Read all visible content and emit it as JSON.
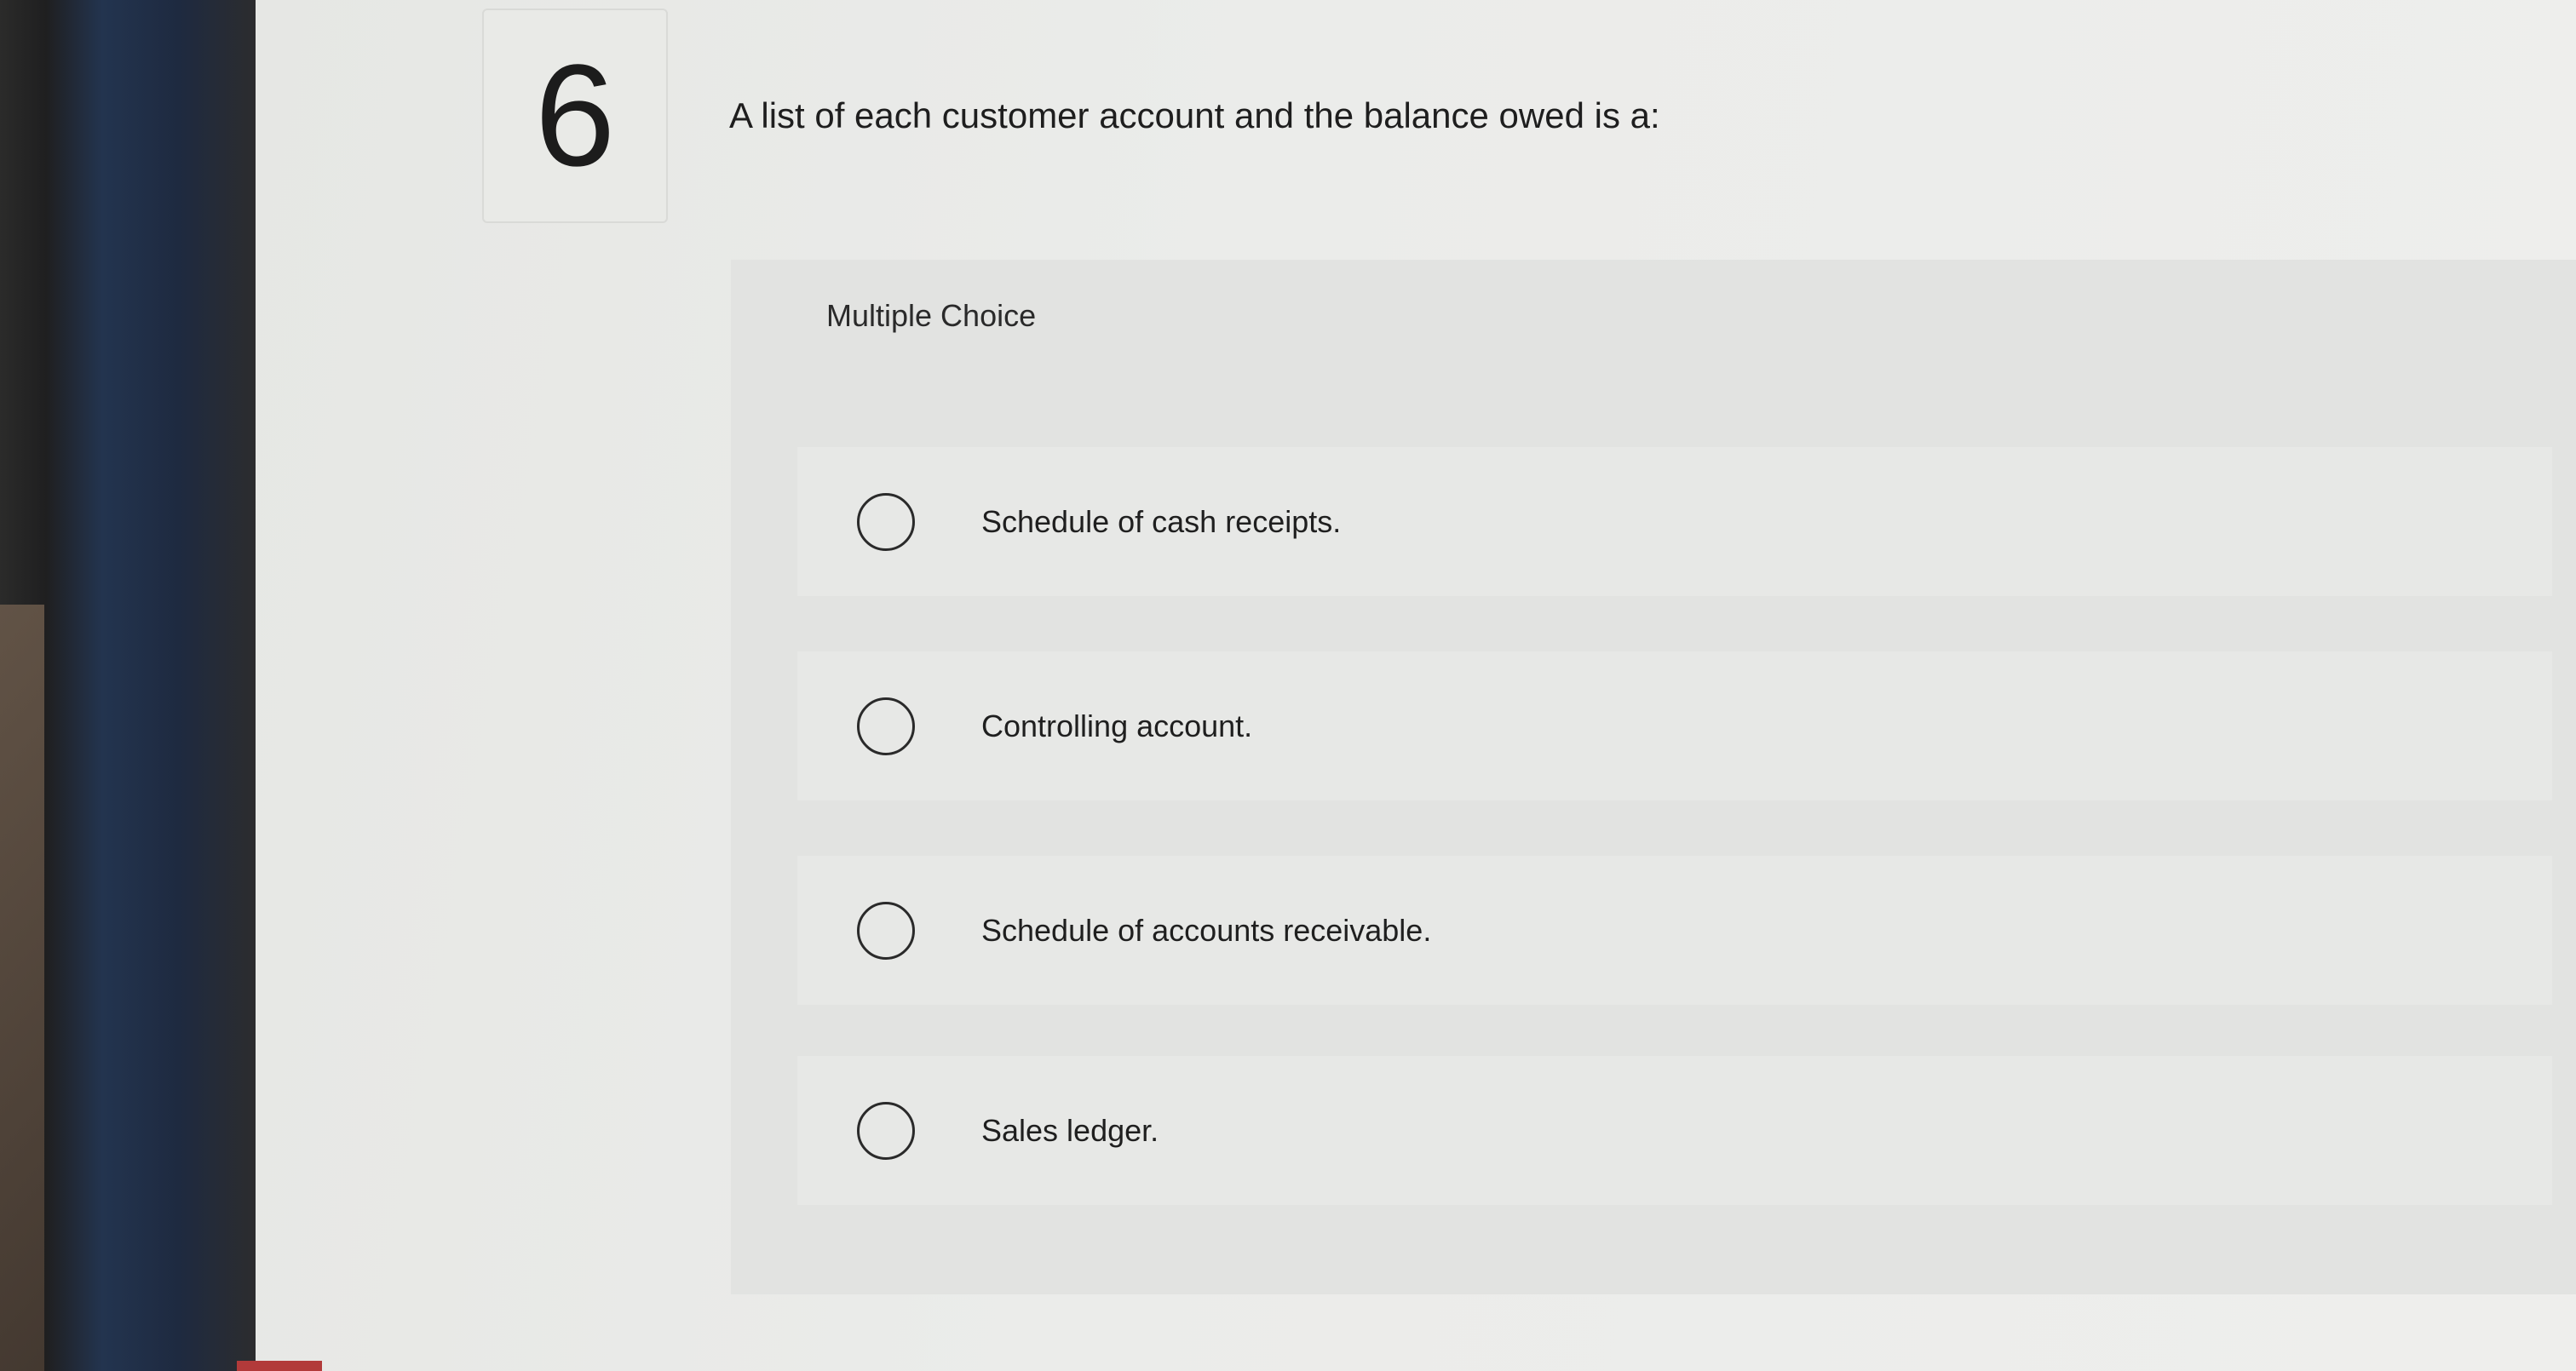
{
  "question": {
    "number": "6",
    "text": "A list of each customer account and the balance owed is a:"
  },
  "multiple_choice": {
    "header": "Multiple Choice",
    "options": [
      {
        "label": "Schedule of cash receipts."
      },
      {
        "label": "Controlling account."
      },
      {
        "label": "Schedule of accounts receivable."
      },
      {
        "label": "Sales ledger."
      }
    ]
  },
  "colors": {
    "background": "#e9eae7",
    "panel": "#e2e3e1",
    "text": "#1e1e1e",
    "bezel": "#1f2a3c"
  }
}
